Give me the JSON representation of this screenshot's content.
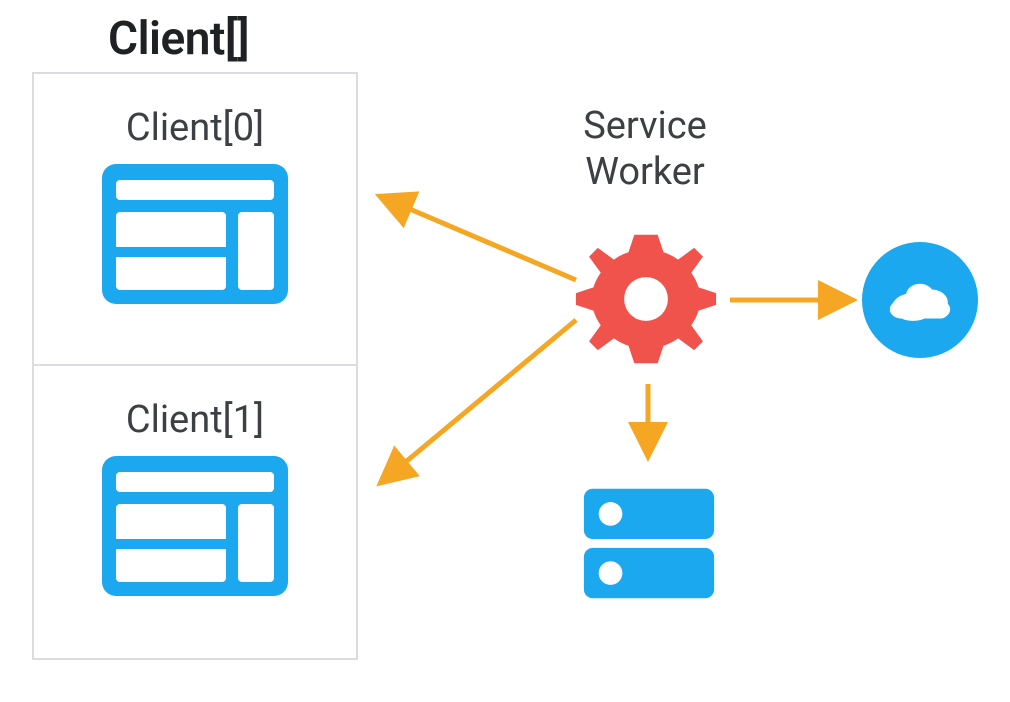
{
  "title": "Client[]",
  "clients": {
    "item0_label": "Client[0]",
    "item1_label": "Client[1]"
  },
  "service_worker_label_line1": "Service",
  "service_worker_label_line2": "Worker",
  "colors": {
    "blue": "#1ba8ef",
    "red": "#f0524c",
    "orange": "#f5a623",
    "border": "#dadce0",
    "text": "#3c4043"
  },
  "icons": {
    "client0": "browser-window-icon",
    "client1": "browser-window-icon",
    "service_worker": "gear-icon",
    "storage": "server-icon",
    "network": "cloud-icon"
  },
  "arrows": [
    {
      "from": "service-worker",
      "to": "client-0",
      "direction": "left-up"
    },
    {
      "from": "service-worker",
      "to": "client-1",
      "direction": "left-down"
    },
    {
      "from": "service-worker",
      "to": "cloud",
      "direction": "right"
    },
    {
      "from": "service-worker",
      "to": "server",
      "direction": "down"
    }
  ]
}
